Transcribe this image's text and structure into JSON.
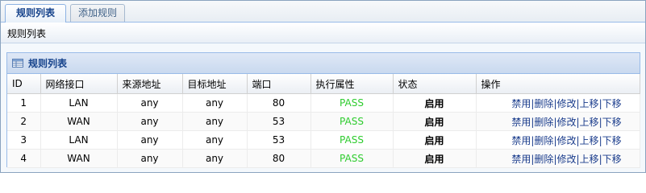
{
  "tabs": [
    {
      "label": "规则列表",
      "active": true
    },
    {
      "label": "添加规则",
      "active": false
    }
  ],
  "page_header": "规则列表",
  "panel": {
    "title": "规则列表",
    "icon": "table-icon"
  },
  "columns": [
    "ID",
    "网络接口",
    "来源地址",
    "目标地址",
    "端口",
    "执行属性",
    "状态",
    "操作"
  ],
  "rows": [
    {
      "id": "1",
      "iface": "LAN",
      "src": "any",
      "dst": "any",
      "port": "80",
      "action": "PASS",
      "status": "启用"
    },
    {
      "id": "2",
      "iface": "WAN",
      "src": "any",
      "dst": "any",
      "port": "53",
      "action": "PASS",
      "status": "启用"
    },
    {
      "id": "3",
      "iface": "LAN",
      "src": "any",
      "dst": "any",
      "port": "53",
      "action": "PASS",
      "status": "启用"
    },
    {
      "id": "4",
      "iface": "WAN",
      "src": "any",
      "dst": "any",
      "port": "80",
      "action": "PASS",
      "status": "启用"
    }
  ],
  "ops": {
    "disable": "禁用",
    "delete": "删除",
    "edit": "修改",
    "up": "上移",
    "down": "下移",
    "separator": "|"
  },
  "colors": {
    "pass": "#2ecc2e",
    "link": "#1a3c8c",
    "header_text": "#15428b"
  }
}
